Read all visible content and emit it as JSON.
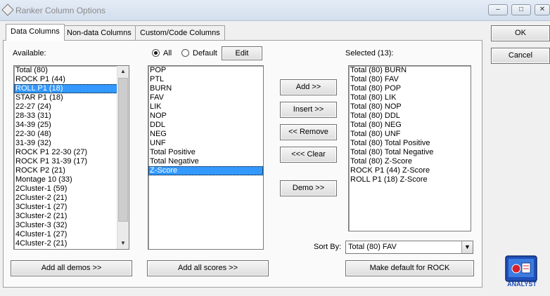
{
  "window": {
    "title": "Ranker Column Options",
    "minimize_glyph": "–",
    "maximize_glyph": "□",
    "close_glyph": "✕"
  },
  "tabs": [
    {
      "label": "Data Columns",
      "active": true
    },
    {
      "label": "Non-data Columns",
      "active": false
    },
    {
      "label": "Custom/Code Columns",
      "active": false
    }
  ],
  "dialog_buttons": {
    "ok": "OK",
    "cancel": "Cancel"
  },
  "available": {
    "label": "Available:",
    "items": [
      "Total (80)",
      "ROCK P1 (44)",
      "ROLL P1 (18)",
      "STAR P1 (18)",
      "22-27 (24)",
      "28-33 (31)",
      "34-39 (25)",
      "22-30 (48)",
      "31-39 (32)",
      "ROCK P1 22-30 (27)",
      "ROCK P1 31-39 (17)",
      "ROCK P2 (21)",
      "Montage 10 (33)",
      "2Cluster-1 (59)",
      "2Cluster-2 (21)",
      "3Cluster-1 (27)",
      "3Cluster-2 (21)",
      "3Cluster-3 (32)",
      "4Cluster-1 (27)",
      "4Cluster-2 (21)"
    ],
    "selected_index": 2,
    "add_all_button": "Add all demos >>"
  },
  "scores": {
    "radio_all": "All",
    "radio_default": "Default",
    "edit_button": "Edit",
    "items": [
      "POP",
      "PTL",
      "BURN",
      "FAV",
      "LIK",
      "NOP",
      "DDL",
      "NEG",
      "UNF",
      "Total Positive",
      "Total Negative",
      "Z-Score"
    ],
    "selected_index": 11,
    "add_all_button": "Add all scores >>"
  },
  "actions": {
    "add": "Add >>",
    "insert": "Insert >>",
    "remove": "<< Remove",
    "clear": "<<< Clear",
    "demo": "Demo >>"
  },
  "selected": {
    "label": "Selected (13):",
    "items": [
      "Total (80) BURN",
      "Total (80) FAV",
      "Total (80) POP",
      "Total (80) LIK",
      "Total (80) NOP",
      "Total (80) DDL",
      "Total (80) NEG",
      "Total (80) UNF",
      "Total (80) Total Positive",
      "Total (80) Total Negative",
      "Total (80) Z-Score",
      "ROCK P1 (44) Z-Score",
      "ROLL P1 (18) Z-Score"
    ]
  },
  "sort": {
    "label": "Sort By:",
    "value": "Total (80) FAV"
  },
  "make_default_button": "Make default for ROCK",
  "logo_text": "ANALYST",
  "colors": {
    "selection": "#3399ff",
    "logo_red": "#d8202a",
    "logo_blue": "#1f4fb8"
  }
}
